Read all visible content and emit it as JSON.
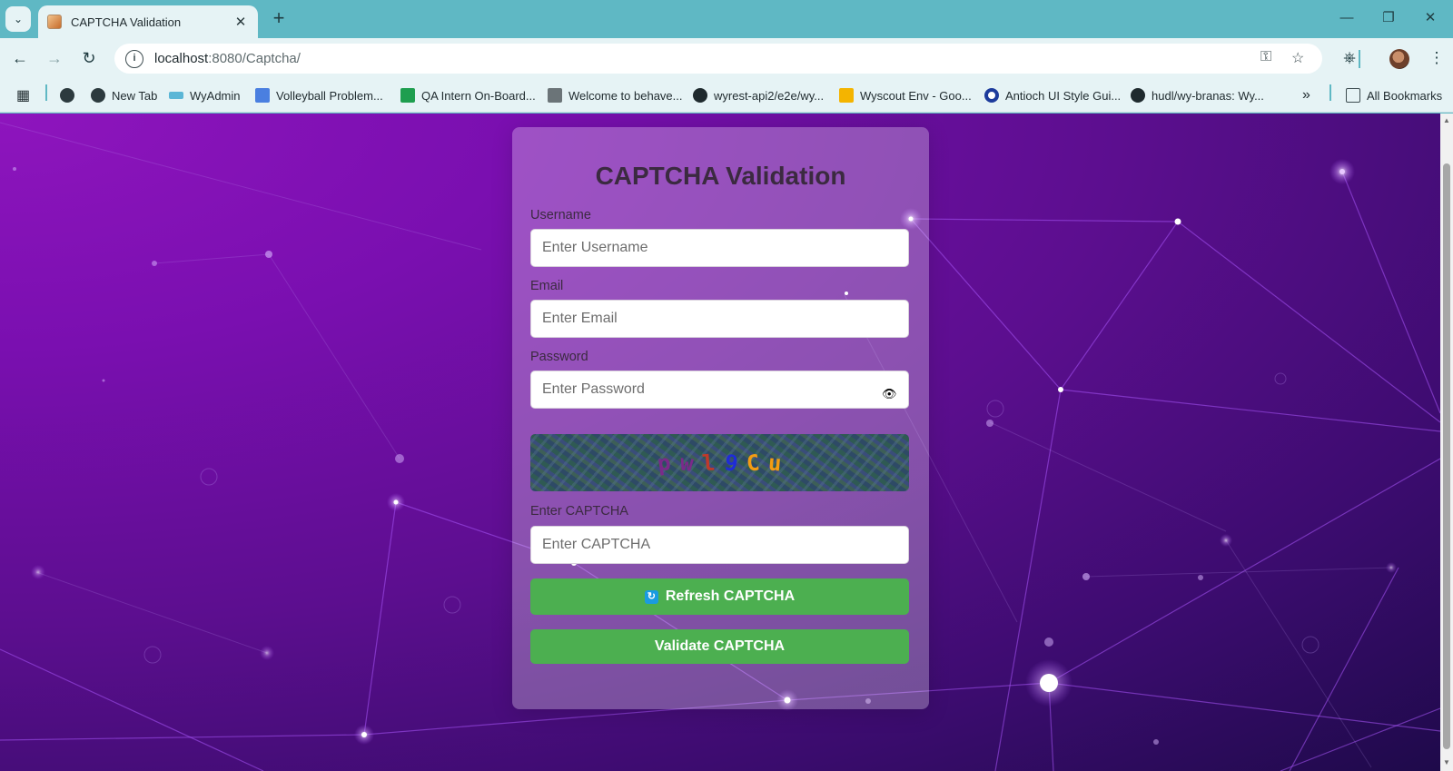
{
  "browser": {
    "tab": {
      "title": "CAPTCHA Validation",
      "favicon": "captcha-favicon"
    },
    "url": {
      "host": "localhost",
      "path": ":8080/Captcha/"
    },
    "bookmarks": [
      {
        "label": "",
        "icon": "globe-icon"
      },
      {
        "label": "New Tab",
        "icon": "globe-icon"
      },
      {
        "label": "WyAdmin",
        "icon": "wyscout-icon"
      },
      {
        "label": "Volleyball Problem...",
        "icon": "docs-icon"
      },
      {
        "label": "QA Intern On-Board...",
        "icon": "sheets-icon"
      },
      {
        "label": "Welcome to behave...",
        "icon": "page-icon"
      },
      {
        "label": "wyrest-api2/e2e/wy...",
        "icon": "github-icon"
      },
      {
        "label": "Wyscout Env - Goo...",
        "icon": "slides-icon"
      },
      {
        "label": "Antioch UI Style Gui...",
        "icon": "circle-icon"
      },
      {
        "label": "hudl/wy-branas: Wy...",
        "icon": "github-icon"
      }
    ],
    "all_bookmarks": "All Bookmarks"
  },
  "form": {
    "title": "CAPTCHA Validation",
    "username": {
      "label": "Username",
      "placeholder": "Enter Username",
      "value": ""
    },
    "email": {
      "label": "Email",
      "placeholder": "Enter Email",
      "value": ""
    },
    "password": {
      "label": "Password",
      "placeholder": "Enter Password",
      "value": ""
    },
    "captcha_chars": [
      {
        "ch": "p",
        "color": "#7b2a8a"
      },
      {
        "ch": "w",
        "color": "#7b2a8a"
      },
      {
        "ch": "l",
        "color": "#c0392b"
      },
      {
        "ch": "9",
        "color": "#1f2bd8"
      },
      {
        "ch": "C",
        "color": "#f39c12"
      },
      {
        "ch": "u",
        "color": "#f39c12"
      }
    ],
    "captcha_input": {
      "label": "Enter CAPTCHA",
      "placeholder": "Enter CAPTCHA",
      "value": ""
    },
    "refresh_label": "Refresh CAPTCHA",
    "validate_label": "Validate CAPTCHA"
  },
  "colors": {
    "button_green": "#4caf50",
    "chrome": "#5fb8c4",
    "toolbar": "#e6f3f5"
  }
}
